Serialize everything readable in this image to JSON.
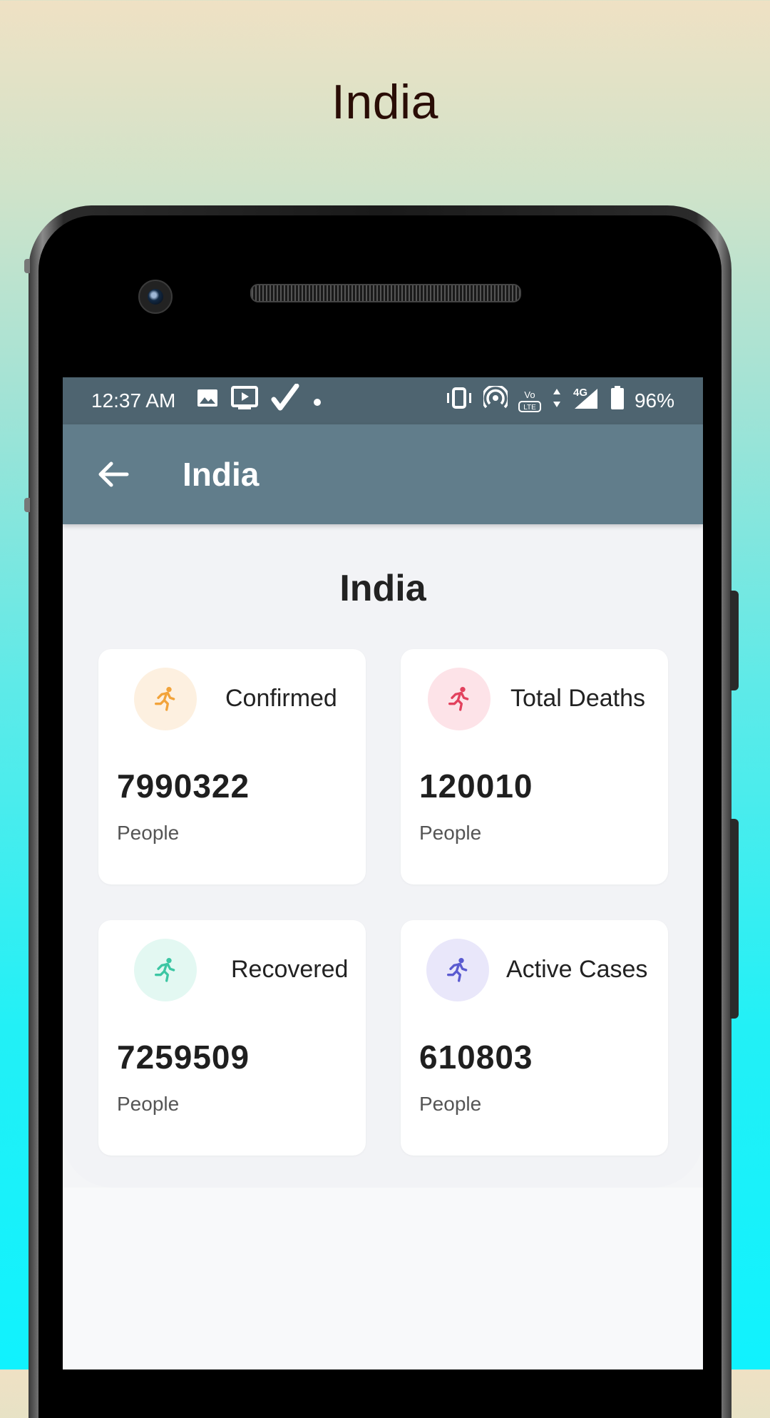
{
  "promo": {
    "title": "India"
  },
  "statusbar": {
    "time": "12:37 AM",
    "network": "4G",
    "volte": "VoLTE",
    "battery": "96%",
    "icons": [
      "image-icon",
      "cast-icon",
      "check-icon",
      "dot-icon",
      "vibrate-icon",
      "hotspot-icon",
      "volte-icon",
      "data-arrows-icon",
      "signal-icon",
      "battery-icon"
    ]
  },
  "appbar": {
    "title": "India",
    "back_icon": "arrow-left-icon"
  },
  "page": {
    "title": "India"
  },
  "stats": [
    {
      "label": "Confirmed",
      "value": "7990322",
      "unit": "People",
      "color": "#f2a33a",
      "bg": "#fdf0e0",
      "icon": "runner-icon"
    },
    {
      "label": "Total Deaths",
      "value": "120010",
      "unit": "People",
      "color": "#e2415d",
      "bg": "#fde3e8",
      "icon": "runner-icon"
    },
    {
      "label": "Recovered",
      "value": "7259509",
      "unit": "People",
      "color": "#3cc6a3",
      "bg": "#e3f8f2",
      "icon": "runner-icon"
    },
    {
      "label": "Active Cases",
      "value": "610803",
      "unit": "People",
      "color": "#5a5ad0",
      "bg": "#e9e7fa",
      "icon": "runner-icon"
    }
  ],
  "colors": {
    "statusbar": "#4e6470",
    "appbar": "#617d8b"
  }
}
